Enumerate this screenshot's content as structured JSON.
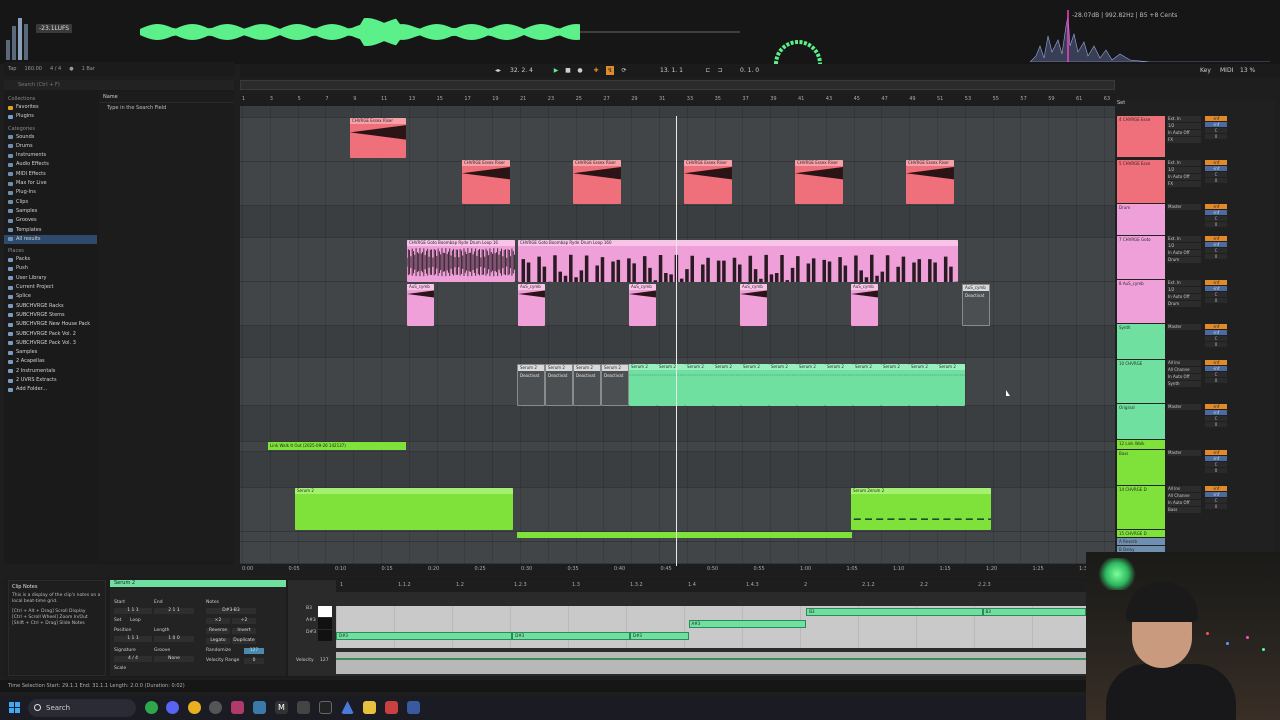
{
  "colors": {
    "clip_red": "#ef6f7a",
    "clip_pink": "#f0a0d8",
    "clip_green": "#6fe0a0",
    "clip_lime": "#7fe23a",
    "waveform_green": "#5cf08a",
    "accent_orange": "#e28a2a",
    "selection_blue": "#2d4a6a"
  },
  "topbar": {
    "lufs_readout": "-23.1LUFS",
    "spectrum_readout": "-28.07dB | 992.82Hz | B5 +8 Cents",
    "tempo": "160.00",
    "time_signature": "4 / 4",
    "quantize": "1 Bar",
    "tap_label": "Tap",
    "position": "32.  2.  4",
    "loop_start": "13.  1.  1",
    "loop_length": "0.  1.  0",
    "key_label": "Key",
    "midi_label": "MIDI",
    "cpu": "13 %"
  },
  "browser": {
    "search_placeholder": "Search (Ctrl + F)",
    "collections_title": "Collections",
    "favorites": "Favorites",
    "plugins_fav": "Plugins",
    "categories_title": "Categories",
    "categories": [
      "Sounds",
      "Drums",
      "Instruments",
      "Audio Effects",
      "MIDI Effects",
      "Max for Live",
      "Plug-Ins",
      "Clips",
      "Samples",
      "Grooves",
      "Templates",
      "All results"
    ],
    "places_title": "Places",
    "places": [
      "Packs",
      "Push",
      "User Library",
      "Current Project",
      "Splice",
      "SUBCHVRGE Racks",
      "SUBCHVRGE Stems",
      "SUBCHVRGE New House Pack",
      "SUBCHVRGE Pack Vol. 2",
      "SUBCHVRGE Pack Vol. 3",
      "Samples",
      "2 Acapellas",
      "2 Instrumentals",
      "2 UVRS Extracts",
      "Add Folder..."
    ],
    "name_header": "Name",
    "hint": "Type in the Search Field"
  },
  "arrangement": {
    "bar_numbers": [
      "1",
      "3",
      "5",
      "7",
      "9",
      "11",
      "13",
      "15",
      "17",
      "19",
      "21",
      "23",
      "25",
      "27",
      "29",
      "31",
      "33",
      "35",
      "37",
      "39",
      "41",
      "43",
      "45",
      "47",
      "49",
      "51",
      "53",
      "55",
      "57",
      "59",
      "61",
      "63"
    ],
    "time_labels": [
      "0:00",
      "0:05",
      "0:10",
      "0:15",
      "0:20",
      "0:25",
      "0:30",
      "0:35",
      "0:40",
      "0:45",
      "0:50",
      "0:55",
      "1:00",
      "1:05",
      "1:10",
      "1:15",
      "1:20",
      "1:25",
      "1:30",
      "1:35"
    ],
    "set_label": "Set",
    "clips": {
      "red_top": "CHVRGE Essex Riser",
      "red_row": "CHVRGE Essex Riser",
      "pink_loop_a": "CHVRGE Goto Boombap Ryde Drum Loop 16",
      "pink_loop_b": "CHVRGE Goto Boombap Ryde Drum Loop 160",
      "cymbal": "AuS_cymb",
      "cymbal_deact": "AuS_cymb",
      "deactivated": "Deactivat",
      "serum": "Serum 2",
      "marker": "Link Walk It Out (2025-09-26 142137)",
      "serum_lime": "Serum 2",
      "serum_lime_b": "Serum 2erum 2"
    }
  },
  "mixer": {
    "tracks": [
      {
        "name": "4 CHVRGE Esse",
        "color": "#ef6f7a",
        "io": [
          "Ext. In",
          "1/2",
          "In Auto Off",
          "FX"
        ]
      },
      {
        "name": "5 CHVRGE Esse",
        "color": "#ef6f7a",
        "io": [
          "Ext. In",
          "1/2",
          "In Auto Off",
          "FX"
        ]
      },
      {
        "name": "Drum",
        "color": "#f0a0d8",
        "io": [
          "Master"
        ]
      },
      {
        "name": "7 CHVRGE Goto",
        "color": "#f0a0d8",
        "io": [
          "Ext. In",
          "1/2",
          "In Auto Off",
          "Drum"
        ]
      },
      {
        "name": "8 AuS_cymb",
        "color": "#f0a0d8",
        "io": [
          "Ext. In",
          "1/2",
          "In Auto Off",
          "Drum"
        ]
      },
      {
        "name": "Synth",
        "color": "#6fe0a0",
        "io": [
          "Master"
        ]
      },
      {
        "name": "10 CHVRGE",
        "color": "#6fe0a0",
        "io": [
          "All Ins",
          "All Channe",
          "In Auto Off",
          "Synth"
        ]
      },
      {
        "name": "Original",
        "color": "#6fe0a0",
        "io": [
          "Master"
        ]
      },
      {
        "name": "12 Link Walk",
        "color": "#7fe23a",
        "io": []
      },
      {
        "name": "Bass",
        "color": "#7fe23a",
        "io": [
          "Master"
        ]
      },
      {
        "name": "14 CHVRGE D",
        "color": "#7fe23a",
        "io": [
          "All Ins",
          "All Channe",
          "In Auto Off",
          "Bass"
        ]
      },
      {
        "name": "15 CHVRGE D",
        "color": "#7fe23a",
        "io": []
      },
      {
        "name": "A Reverb",
        "color": "#6f8fb0",
        "io": []
      },
      {
        "name": "B Delay",
        "color": "#6f8fb0",
        "io": []
      }
    ],
    "vol_values": [
      "-inf",
      "-inf",
      "C",
      "0"
    ]
  },
  "detail": {
    "info_title": "Clip Notes",
    "info_text": "This is a display of the clip's notes on a local beat-time grid.",
    "info_shortcuts": [
      "[Ctrl + Alt + Drag] Scroll Display",
      "[Ctrl + Scroll Wheel] Zoom In/Out",
      "[Shift + Ctrl + Drag] Slide Notes"
    ],
    "clip_name": "Serum 2",
    "labels": {
      "start": "Start",
      "end": "End",
      "position": "Position",
      "length": "Length",
      "signature": "Signature",
      "groove": "Groove",
      "scale": "Scale",
      "notes": "Notes",
      "set": "Set",
      "loop": "Loop",
      "reverse": "Reverse",
      "invert": "Invert",
      "legato": "Legato",
      "duplicate": "Duplicate",
      "randomize": "Randomize",
      "velocity_range": "Velocity Range",
      "x2": "×2",
      "div2": "÷2"
    },
    "values": {
      "start": "1  1  1",
      "end": "2  1  1",
      "position": "1  1  1",
      "length": "1  0  0",
      "signature": "4 / 4",
      "groove": "None",
      "notes": "D#3-B3",
      "randomize": "127",
      "velocity_range": "0"
    },
    "pr_ruler": [
      "1",
      "1.1.2",
      "1.2",
      "1.2.3",
      "1.3",
      "1.3.2",
      "1.4",
      "1.4.3",
      "2",
      "2.1.2",
      "2.2",
      "2.2.3"
    ],
    "keys": [
      "B3",
      "A#3",
      "D#3"
    ],
    "notes": [
      {
        "label": "D#3",
        "row": 2,
        "start": 0.0,
        "len": 0.235
      },
      {
        "label": "D#3",
        "row": 2,
        "start": 0.235,
        "len": 0.157
      },
      {
        "label": "D#3",
        "row": 2,
        "start": 0.392,
        "len": 0.078
      },
      {
        "label": "A#3",
        "row": 1,
        "start": 0.47,
        "len": 0.157
      },
      {
        "label": "B3",
        "row": 0,
        "start": 0.627,
        "len": 0.235
      },
      {
        "label": "B3",
        "row": 0,
        "start": 0.862,
        "len": 0.138
      }
    ],
    "velocity_label": "Velocity",
    "velocity_max": "127"
  },
  "status": {
    "text": "Time Selection   Start: 29.1.1   End: 31.1.1   Length: 2.0.0  (Duration: 0:02)"
  },
  "taskbar": {
    "search_placeholder": "Search"
  }
}
